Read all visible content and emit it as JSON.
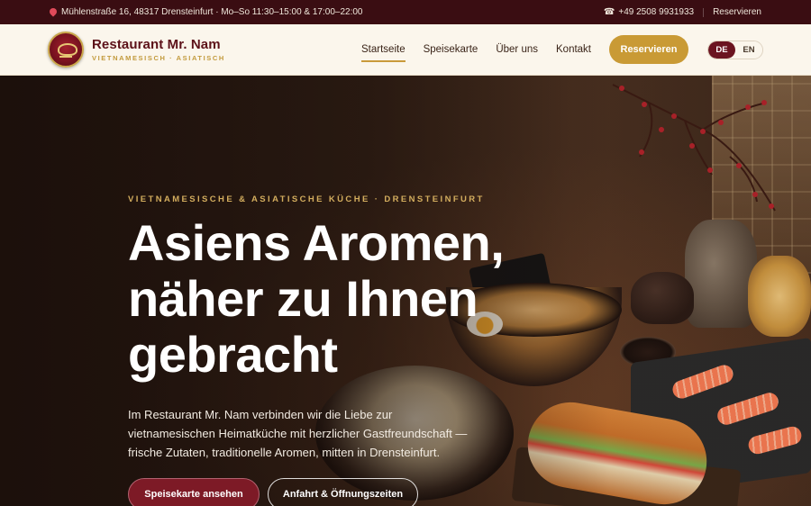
{
  "topbar": {
    "address": "Mühlenstraße 16, 48317 Drensteinfurt · Mo–So 11:30–15:00 & 17:00–22:00",
    "phone": "+49 2508 9931933",
    "reserve_link": "Reservieren",
    "icons": {
      "location": "pin-icon",
      "phone": "phone-icon"
    }
  },
  "header": {
    "brand_name": "Restaurant Mr. Nam",
    "brand_sub": "VIETNAMESISCH · ASIATISCH",
    "nav": [
      {
        "label": "Startseite",
        "active": true
      },
      {
        "label": "Speisekarte",
        "active": false
      },
      {
        "label": "Über uns",
        "active": false
      },
      {
        "label": "Kontakt",
        "active": false
      }
    ],
    "reserve_button": "Reservieren",
    "languages": {
      "de": "DE",
      "en": "EN",
      "selected": "DE"
    }
  },
  "hero": {
    "eyebrow": "VIETNAMESISCHE & ASIATISCHE KÜCHE · DRENSTEINFURT",
    "headline": "Asiens Aromen, näher zu Ihnen gebracht",
    "lead": "Im Restaurant Mr. Nam verbinden wir die Liebe zur vietnamesischen Heimatküche mit herzlicher Gastfreundschaft — frische Zutaten, traditionelle Aromen, mitten in Drensteinfurt.",
    "cta_primary": "Speisekarte ansehen",
    "cta_secondary": "Anfahrt & Öffnungszeiten"
  },
  "colors": {
    "topbar_bg": "#3a0d12",
    "header_bg": "#fbf6ec",
    "brand": "#5c1119",
    "accent_gold": "#c99a35",
    "primary_button": "#7d1a26"
  }
}
